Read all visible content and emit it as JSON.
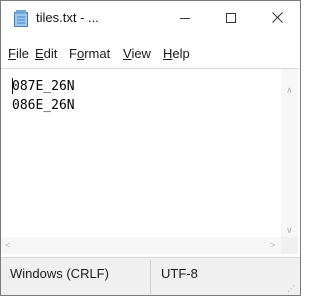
{
  "window": {
    "title": "tiles.txt - ...",
    "icon": "notepad-icon",
    "controls": {
      "minimize_icon": "minimize-icon",
      "maximize_icon": "maximize-icon",
      "close_icon": "close-icon"
    }
  },
  "menu": {
    "items": [
      {
        "label": "File",
        "access": "F",
        "rest": "ile"
      },
      {
        "label": "Edit",
        "access": "E",
        "rest": "dit"
      },
      {
        "label": "Format",
        "pre": "F",
        "access": "o",
        "rest": "rmat"
      },
      {
        "label": "View",
        "access": "V",
        "rest": "iew"
      },
      {
        "label": "Help",
        "access": "H",
        "rest": "elp"
      }
    ]
  },
  "editor": {
    "lines": [
      "087E_26N",
      "086E_26N"
    ]
  },
  "status": {
    "line_ending": "Windows (CRLF)",
    "encoding": "UTF-8"
  },
  "colors": {
    "border": "#7a7a7a",
    "statusbar": "#f0f0f0",
    "scrollbar": "#f7f7f7"
  }
}
